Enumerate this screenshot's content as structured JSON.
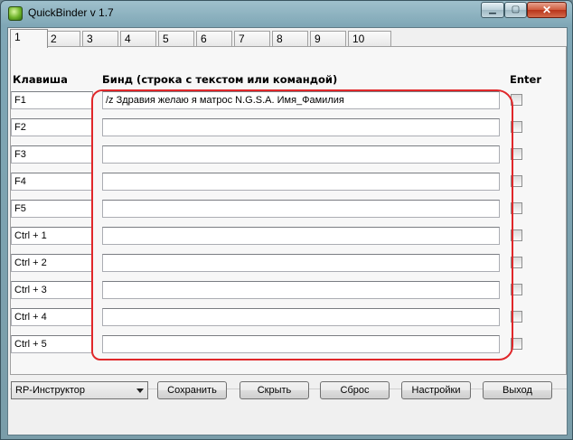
{
  "window": {
    "title": "QuickBinder v 1.7"
  },
  "tabs": [
    "1",
    "2",
    "3",
    "4",
    "5",
    "6",
    "7",
    "8",
    "9",
    "10"
  ],
  "headers": {
    "key": "Клавиша",
    "bind": "Бинд (строка с текстом или командой)",
    "enter": "Enter"
  },
  "rows": [
    {
      "key": "F1",
      "bind": "/z Здравия желаю я матрос N.G.S.A. Имя_Фамилия",
      "enter": false
    },
    {
      "key": "F2",
      "bind": "",
      "enter": false
    },
    {
      "key": "F3",
      "bind": "",
      "enter": false
    },
    {
      "key": "F4",
      "bind": "",
      "enter": false
    },
    {
      "key": "F5",
      "bind": "",
      "enter": false
    },
    {
      "key": "Ctrl + 1",
      "bind": "",
      "enter": false
    },
    {
      "key": "Ctrl + 2",
      "bind": "",
      "enter": false
    },
    {
      "key": "Ctrl + 3",
      "bind": "",
      "enter": false
    },
    {
      "key": "Ctrl + 4",
      "bind": "",
      "enter": false
    },
    {
      "key": "Ctrl + 5",
      "bind": "",
      "enter": false
    }
  ],
  "profile": {
    "selected": "RP-Инструктор"
  },
  "buttons": {
    "save": "Сохранить",
    "hide": "Скрыть",
    "reset": "Сброс",
    "settings": "Настройки",
    "exit": "Выход"
  },
  "colors": {
    "highlight": "#e0272a"
  }
}
